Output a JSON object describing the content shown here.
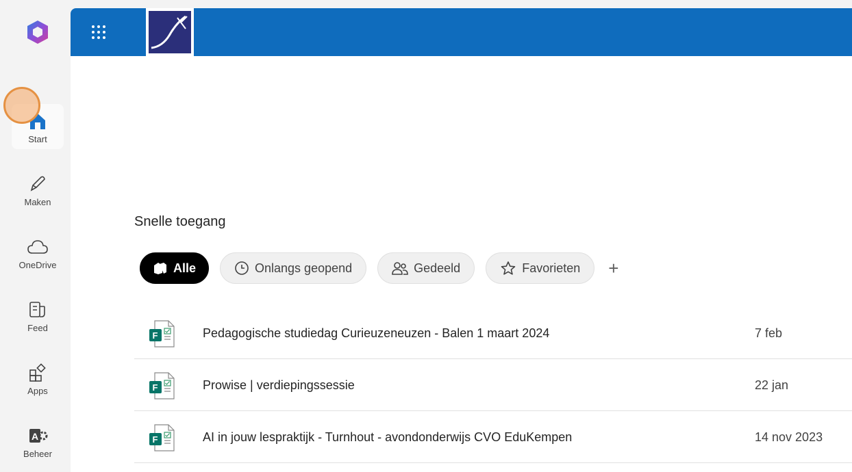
{
  "rail": {
    "items": [
      {
        "label": "Start",
        "icon": "home-icon"
      },
      {
        "label": "Maken",
        "icon": "pen-icon"
      },
      {
        "label": "OneDrive",
        "icon": "cloud-icon"
      },
      {
        "label": "Feed",
        "icon": "feed-icon"
      },
      {
        "label": "Apps",
        "icon": "apps-icon"
      },
      {
        "label": "Beheer",
        "icon": "admin-icon"
      }
    ]
  },
  "header": {
    "accent": "#0f6cbd"
  },
  "quick_access": {
    "title": "Snelle toegang",
    "filters": [
      {
        "label": "Alle",
        "icon": "all-icon",
        "selected": true
      },
      {
        "label": "Onlangs geopend",
        "icon": "clock-icon",
        "selected": false
      },
      {
        "label": "Gedeeld",
        "icon": "people-icon",
        "selected": false
      },
      {
        "label": "Favorieten",
        "icon": "star-icon",
        "selected": false
      }
    ],
    "add_label": "+",
    "files": [
      {
        "name": "Pedagogische studiedag Curieuzeneuzen - Balen 1 maart 2024",
        "date": "7 feb",
        "icon": "forms-icon"
      },
      {
        "name": "Prowise | verdiepingssessie",
        "date": "22 jan",
        "icon": "forms-icon"
      },
      {
        "name": "AI in jouw lespraktijk - Turnhout - avondonderwijs CVO EduKempen",
        "date": "14 nov 2023",
        "icon": "forms-icon"
      }
    ]
  }
}
